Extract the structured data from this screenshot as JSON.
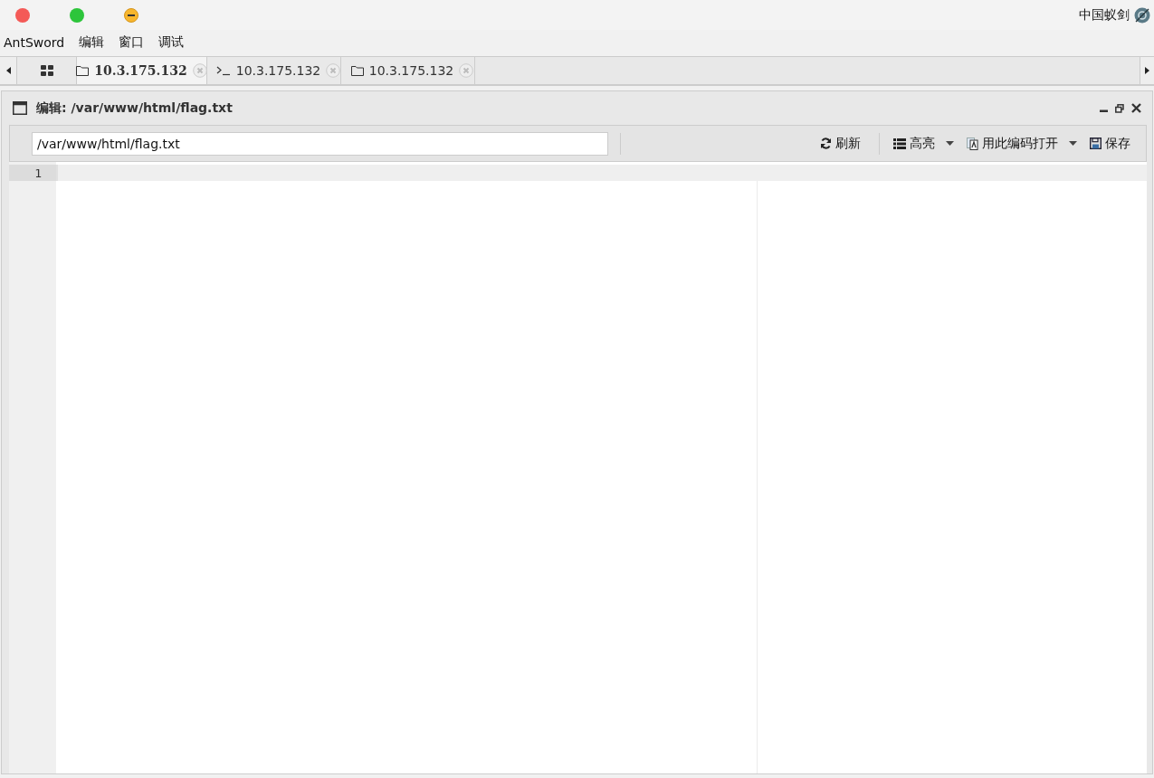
{
  "app_title": "中国蚁剑",
  "menu": [
    "AntSword",
    "编辑",
    "窗口",
    "调试"
  ],
  "tabs": [
    {
      "kind": "home",
      "selected": false
    },
    {
      "kind": "folder",
      "label": "10.3.175.132",
      "selected": true
    },
    {
      "kind": "terminal",
      "label": "10.3.175.132",
      "selected": false
    },
    {
      "kind": "folder",
      "label": "10.3.175.132",
      "selected": false
    }
  ],
  "panel": {
    "title": "编辑: /var/www/html/flag.txt",
    "path_field": {
      "value": "/var/www/html/flag.txt"
    },
    "toolbar": [
      {
        "kind": "refresh",
        "label": "刷新",
        "dropdown": false
      },
      {
        "kind": "list",
        "label": "高亮",
        "dropdown": true
      },
      {
        "kind": "encoding",
        "label": "用此编码打开",
        "dropdown": true
      },
      {
        "kind": "save",
        "label": "保存",
        "dropdown": false
      }
    ],
    "editor": {
      "lines": [
        {
          "number": "1",
          "active": true
        }
      ]
    }
  }
}
